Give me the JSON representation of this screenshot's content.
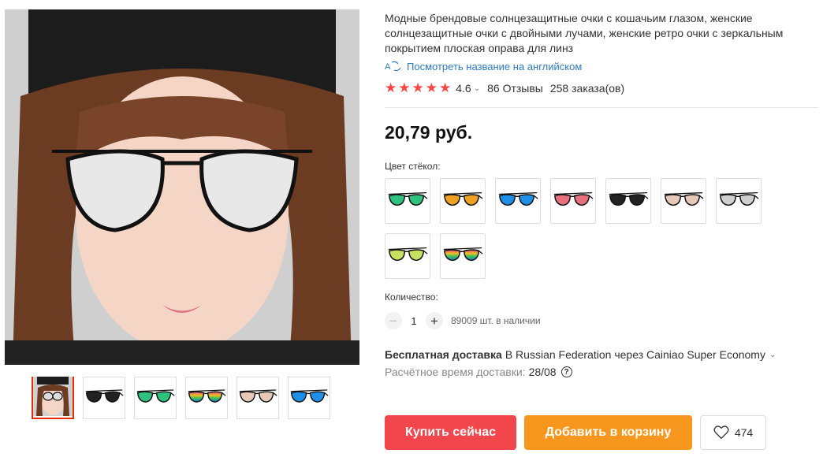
{
  "product": {
    "title": "Модные брендовые солнцезащитные очки с кошачьим глазом, женские солнцезащитные очки с двойными лучами, женские ретро очки с зеркальным покрытием плоская оправа для линз",
    "translate_link": "Посмотреть название на английском",
    "rating": "4.6",
    "reviews": "86 Отзывы",
    "orders": "258 заказа(ов)",
    "price": "20,79 руб."
  },
  "options": {
    "color_label": "Цвет стёкол:",
    "swatches": [
      {
        "icon": "sunglasses-green-icon",
        "lens": "#2ec27e"
      },
      {
        "icon": "sunglasses-orange-icon",
        "lens": "#f0a020"
      },
      {
        "icon": "sunglasses-blue-icon",
        "lens": "#1e90e8"
      },
      {
        "icon": "sunglasses-pink-icon",
        "lens": "#e8707e"
      },
      {
        "icon": "sunglasses-black-icon",
        "lens": "#222222"
      },
      {
        "icon": "sunglasses-beige-icon",
        "lens": "#e8c8b8"
      },
      {
        "icon": "sunglasses-silver-icon",
        "lens": "#d0d0d0"
      },
      {
        "icon": "sunglasses-yellow-green-icon",
        "lens": "#c8e060"
      },
      {
        "icon": "sunglasses-rainbow-icon",
        "lens": "#e060c0"
      }
    ]
  },
  "quantity": {
    "label": "Количество:",
    "minus": "−",
    "value": "1",
    "plus": "+",
    "available": "89009 шт. в наличии"
  },
  "shipping": {
    "free": "Бесплатная доставка",
    "details": "В Russian Federation через Cainiao Super Economy",
    "eta_label": "Расчётное время доставки:",
    "eta_date": "28/08",
    "help_glyph": "?"
  },
  "actions": {
    "buy": "Купить сейчас",
    "cart": "Добавить в корзину",
    "wishlist_count": "474"
  },
  "gallery": {
    "main_icon": "product-photo",
    "thumbs": [
      {
        "icon": "thumb-model-icon",
        "lens": "#c0c0c0"
      },
      {
        "icon": "thumb-black-icon",
        "lens": "#222222"
      },
      {
        "icon": "thumb-green-icon",
        "lens": "#2ec27e"
      },
      {
        "icon": "thumb-rainbow-icon",
        "lens": "#e060c0"
      },
      {
        "icon": "thumb-beige-icon",
        "lens": "#e8c8b8"
      },
      {
        "icon": "thumb-blue-icon",
        "lens": "#1e90e8"
      }
    ]
  },
  "colors": {
    "buy": "#f2464d",
    "cart": "#f8971e",
    "stars": "#ff4747",
    "link": "#2e7ac0"
  }
}
